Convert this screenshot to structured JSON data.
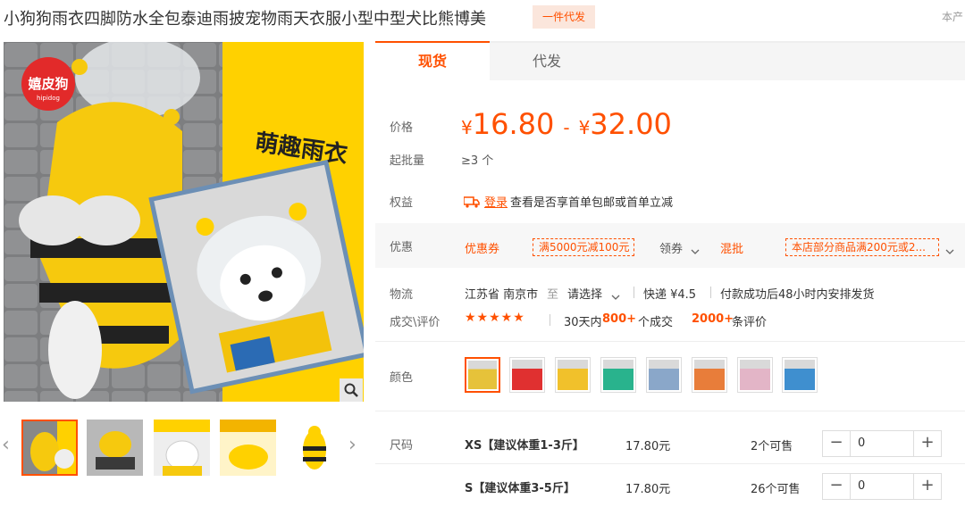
{
  "header": {
    "title": "小狗狗雨衣四脚防水全包泰迪雨披宠物雨天衣服小型中型犬比熊博美",
    "badge": "一件代发",
    "corner": "本产"
  },
  "gallery": {
    "brand_text": "嬉皮狗",
    "brand_sub": "hipidog",
    "promo_text": "萌趣雨衣"
  },
  "tabs": [
    {
      "label": "现货",
      "active": true
    },
    {
      "label": "代发",
      "active": false
    }
  ],
  "price": {
    "label": "价格",
    "currency": "¥",
    "low": "16.80",
    "high": "32.00",
    "separator": "-"
  },
  "moq": {
    "label": "起批量",
    "value": "≥3 个"
  },
  "rights": {
    "label": "权益",
    "login": "登录",
    "text": "查看是否享首单包邮或首单立减"
  },
  "promo": {
    "label": "优惠",
    "coupon_label": "优惠券",
    "coupon": "满5000元减100元",
    "get_coupon": "领券",
    "mix_label": "混批",
    "mix_text": "本店部分商品满200元或2..."
  },
  "logistics": {
    "label": "物流",
    "from": "江苏省 南京市",
    "to_word": "至",
    "select": "请选择",
    "express": "快递 ¥4.5",
    "note": "付款成功后48小时内安排发货"
  },
  "deals": {
    "label": "成交\\评价",
    "stars": "★★★★★",
    "prefix": "30天内",
    "count": "800+",
    "count_suffix": "个成交",
    "reviews": "2000+",
    "reviews_suffix": "条评价"
  },
  "color": {
    "label": "颜色",
    "swatches": [
      "#e6c23a",
      "#e03030",
      "#f1c12b",
      "#29b38d",
      "#8aa7c9",
      "#e87d3a",
      "#e3b5c7",
      "#3f8fcf"
    ]
  },
  "sizes": {
    "label": "尺码",
    "rows": [
      {
        "name": "XS【建议体重1-3斤】",
        "price": "17.80元",
        "stock": "2个可售",
        "qty": "0"
      },
      {
        "name": "S【建议体重3-5斤】",
        "price": "17.80元",
        "stock": "26个可售",
        "qty": "0"
      }
    ]
  },
  "colors": {
    "accent": "#ff5000",
    "yellow": "#ffd100"
  }
}
